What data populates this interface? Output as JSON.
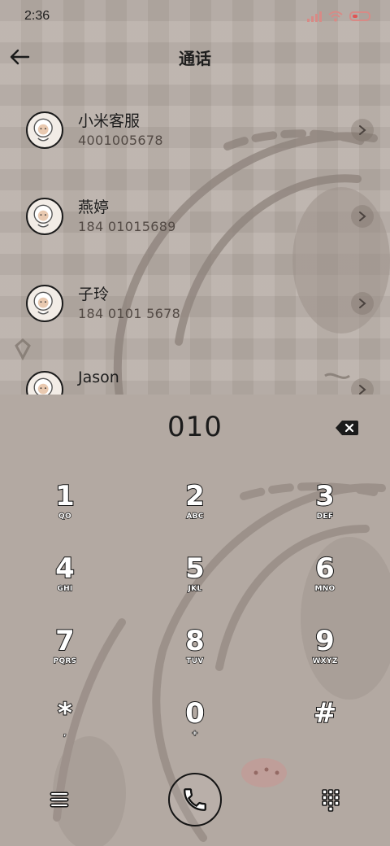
{
  "status_bar": {
    "time": "2:36"
  },
  "header": {
    "title": "通话"
  },
  "contacts": [
    {
      "name": "小米客服",
      "number": "4001005678"
    },
    {
      "name": "燕婷",
      "number": "184 01015689"
    },
    {
      "name": "子玲",
      "number": "184 0101 5678"
    },
    {
      "name": "Jason",
      "number": ""
    }
  ],
  "dialer": {
    "number": "010",
    "keys": [
      {
        "digit": "1",
        "letters": "QO"
      },
      {
        "digit": "2",
        "letters": "ABC"
      },
      {
        "digit": "3",
        "letters": "DEF"
      },
      {
        "digit": "4",
        "letters": "GHI"
      },
      {
        "digit": "5",
        "letters": "JKL"
      },
      {
        "digit": "6",
        "letters": "MNO"
      },
      {
        "digit": "7",
        "letters": "PQRS"
      },
      {
        "digit": "8",
        "letters": "TUV"
      },
      {
        "digit": "9",
        "letters": "WXYZ"
      },
      {
        "digit": "*",
        "letters": ","
      },
      {
        "digit": "0",
        "letters": "+"
      },
      {
        "digit": "#",
        "letters": ""
      }
    ]
  },
  "icons": {
    "back": "arrow-left-icon",
    "backspace": "backspace-icon",
    "menu": "menu-icon",
    "call": "phone-icon",
    "keypad": "dialpad-icon",
    "chevron": "chevron-right-icon"
  },
  "colors": {
    "background": "#b7ada6",
    "text": "#1b1b1b",
    "secondary_text": "#534a45",
    "status_accent": "#d88a86"
  }
}
